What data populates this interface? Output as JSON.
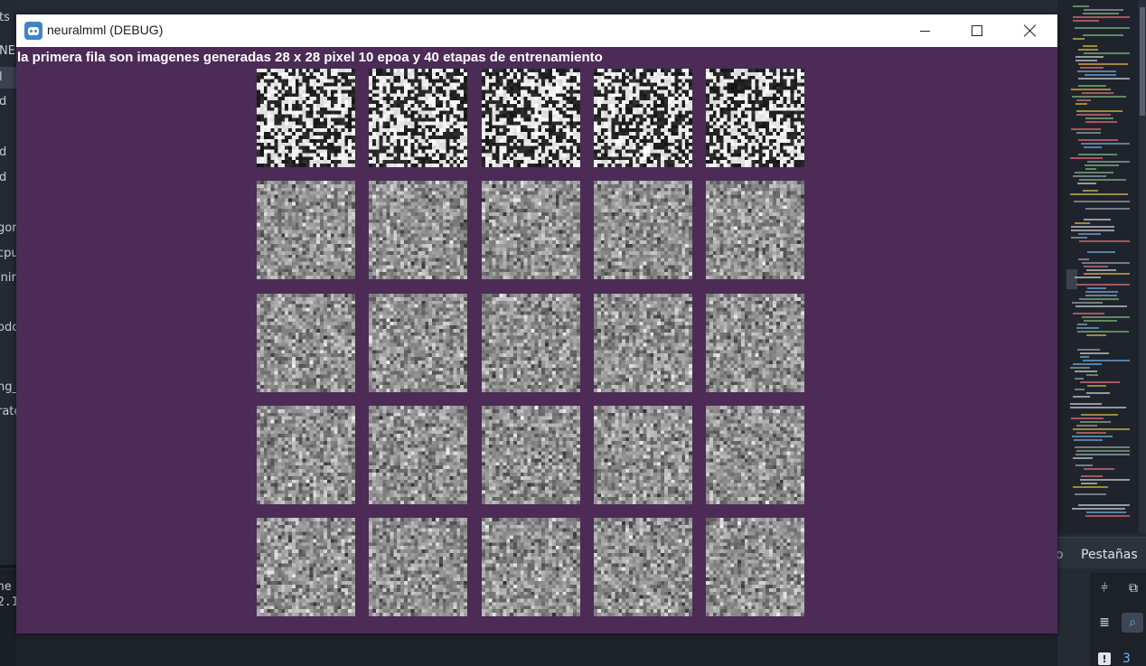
{
  "window": {
    "title": "neuralmml (DEBUG)",
    "caption": "la primera fila son imagenes generadas  28 x 28 pixel 10 epoa y 40 etapas de entrenamiento",
    "background_color": "#4c2b57",
    "controls": [
      "minimize-icon",
      "maximize-icon",
      "close-icon"
    ]
  },
  "image_grid": {
    "rows": 5,
    "columns": 5,
    "image_resolution": "28 x 28",
    "row_styles": [
      "high-contrast",
      "grayscale-noise",
      "grayscale-noise",
      "grayscale-noise",
      "grayscale-noise"
    ]
  },
  "background_editor": {
    "left_fragments": [
      "ts",
      "NE",
      "l",
      "d",
      "d",
      "d",
      "gor",
      "cpu",
      "inir",
      "odo",
      "ng_",
      "rate"
    ],
    "bottom_left_fragments": [
      "ne",
      "2.1"
    ],
    "bottom_tabs": {
      "partial": "o",
      "active": "Pestañas"
    },
    "warning_count": "3"
  }
}
